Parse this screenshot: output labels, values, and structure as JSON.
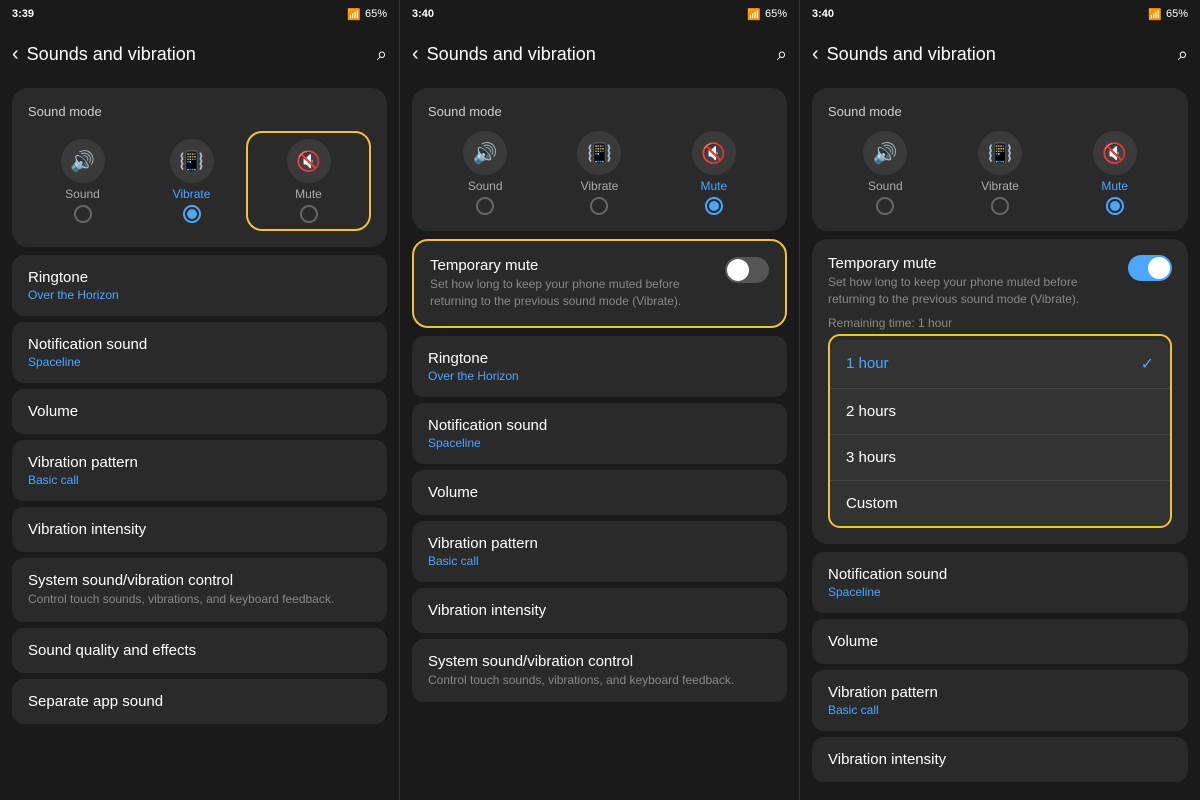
{
  "panel1": {
    "statusBar": {
      "time": "3:39",
      "battery": "65%",
      "icons": "📶🔔"
    },
    "header": {
      "title": "Sounds and vibration",
      "back": "‹",
      "search": "🔍"
    },
    "soundMode": {
      "title": "Sound mode",
      "modes": [
        {
          "id": "sound",
          "label": "Sound",
          "icon": "🔊",
          "active": false,
          "selected": false
        },
        {
          "id": "vibrate",
          "label": "Vibrate",
          "icon": "📳",
          "active": false,
          "selected": true
        },
        {
          "id": "mute",
          "label": "Mute",
          "icon": "🔇",
          "active": true,
          "selected": false
        }
      ],
      "highlight": "mute"
    },
    "items": [
      {
        "id": "ringtone",
        "title": "Ringtone",
        "sub": "Over the Horizon"
      },
      {
        "id": "notification",
        "title": "Notification sound",
        "sub": "Spaceline"
      },
      {
        "id": "volume",
        "title": "Volume",
        "sub": ""
      },
      {
        "id": "vibration-pattern",
        "title": "Vibration pattern",
        "sub": "Basic call"
      },
      {
        "id": "vibration-intensity",
        "title": "Vibration intensity",
        "sub": ""
      },
      {
        "id": "system-sound",
        "title": "System sound/vibration control",
        "sub": "",
        "desc": "Control touch sounds, vibrations, and keyboard feedback."
      },
      {
        "id": "sound-quality",
        "title": "Sound quality and effects",
        "sub": ""
      },
      {
        "id": "separate-app",
        "title": "Separate app sound",
        "sub": ""
      }
    ]
  },
  "panel2": {
    "statusBar": {
      "time": "3:40",
      "battery": "65%"
    },
    "header": {
      "title": "Sounds and vibration"
    },
    "soundMode": {
      "title": "Sound mode",
      "modes": [
        {
          "id": "sound",
          "label": "Sound",
          "active": false,
          "selected": false
        },
        {
          "id": "vibrate",
          "label": "Vibrate",
          "active": false,
          "selected": false
        },
        {
          "id": "mute",
          "label": "Mute",
          "active": true,
          "selected": true
        }
      ]
    },
    "temporaryMute": {
      "title": "Temporary mute",
      "desc": "Set how long to keep your phone muted before returning to the previous sound mode (Vibrate).",
      "enabled": false,
      "highlight": true
    },
    "items": [
      {
        "id": "ringtone",
        "title": "Ringtone",
        "sub": "Over the Horizon"
      },
      {
        "id": "notification",
        "title": "Notification sound",
        "sub": "Spaceline"
      },
      {
        "id": "volume",
        "title": "Volume",
        "sub": ""
      },
      {
        "id": "vibration-pattern",
        "title": "Vibration pattern",
        "sub": "Basic call"
      },
      {
        "id": "vibration-intensity",
        "title": "Vibration intensity",
        "sub": ""
      },
      {
        "id": "system-sound",
        "title": "System sound/vibration control",
        "sub": "",
        "desc": "Control touch sounds, vibrations, and keyboard feedback."
      }
    ]
  },
  "panel3": {
    "statusBar": {
      "time": "3:40",
      "battery": "65%"
    },
    "header": {
      "title": "Sounds and vibration"
    },
    "soundMode": {
      "title": "Sound mode",
      "modes": [
        {
          "id": "sound",
          "label": "Sound",
          "active": false,
          "selected": false
        },
        {
          "id": "vibrate",
          "label": "Vibrate",
          "active": false,
          "selected": false
        },
        {
          "id": "mute",
          "label": "Mute",
          "active": true,
          "selected": true
        }
      ]
    },
    "temporaryMute": {
      "title": "Temporary mute",
      "desc": "Set how long to keep your phone muted before returning to the previous sound mode (Vibrate).",
      "enabled": true,
      "remainingTime": "Remaining time: 1 hour"
    },
    "dropdown": {
      "options": [
        {
          "id": "1hour",
          "label": "1 hour",
          "selected": true
        },
        {
          "id": "2hours",
          "label": "2 hours",
          "selected": false
        },
        {
          "id": "3hours",
          "label": "3 hours",
          "selected": false
        },
        {
          "id": "custom",
          "label": "Custom",
          "selected": false
        }
      ],
      "highlight": true
    },
    "items": [
      {
        "id": "notification",
        "title": "Notification sound",
        "sub": "Spaceline"
      },
      {
        "id": "volume",
        "title": "Volume",
        "sub": ""
      },
      {
        "id": "vibration-pattern",
        "title": "Vibration pattern",
        "sub": "Basic call"
      },
      {
        "id": "vibration-intensity",
        "title": "Vibration intensity",
        "sub": ""
      }
    ]
  },
  "icons": {
    "sound": "🔊",
    "vibrate": "📳",
    "mute": "🔇",
    "back": "‹",
    "search": "⌕",
    "check": "✓"
  }
}
